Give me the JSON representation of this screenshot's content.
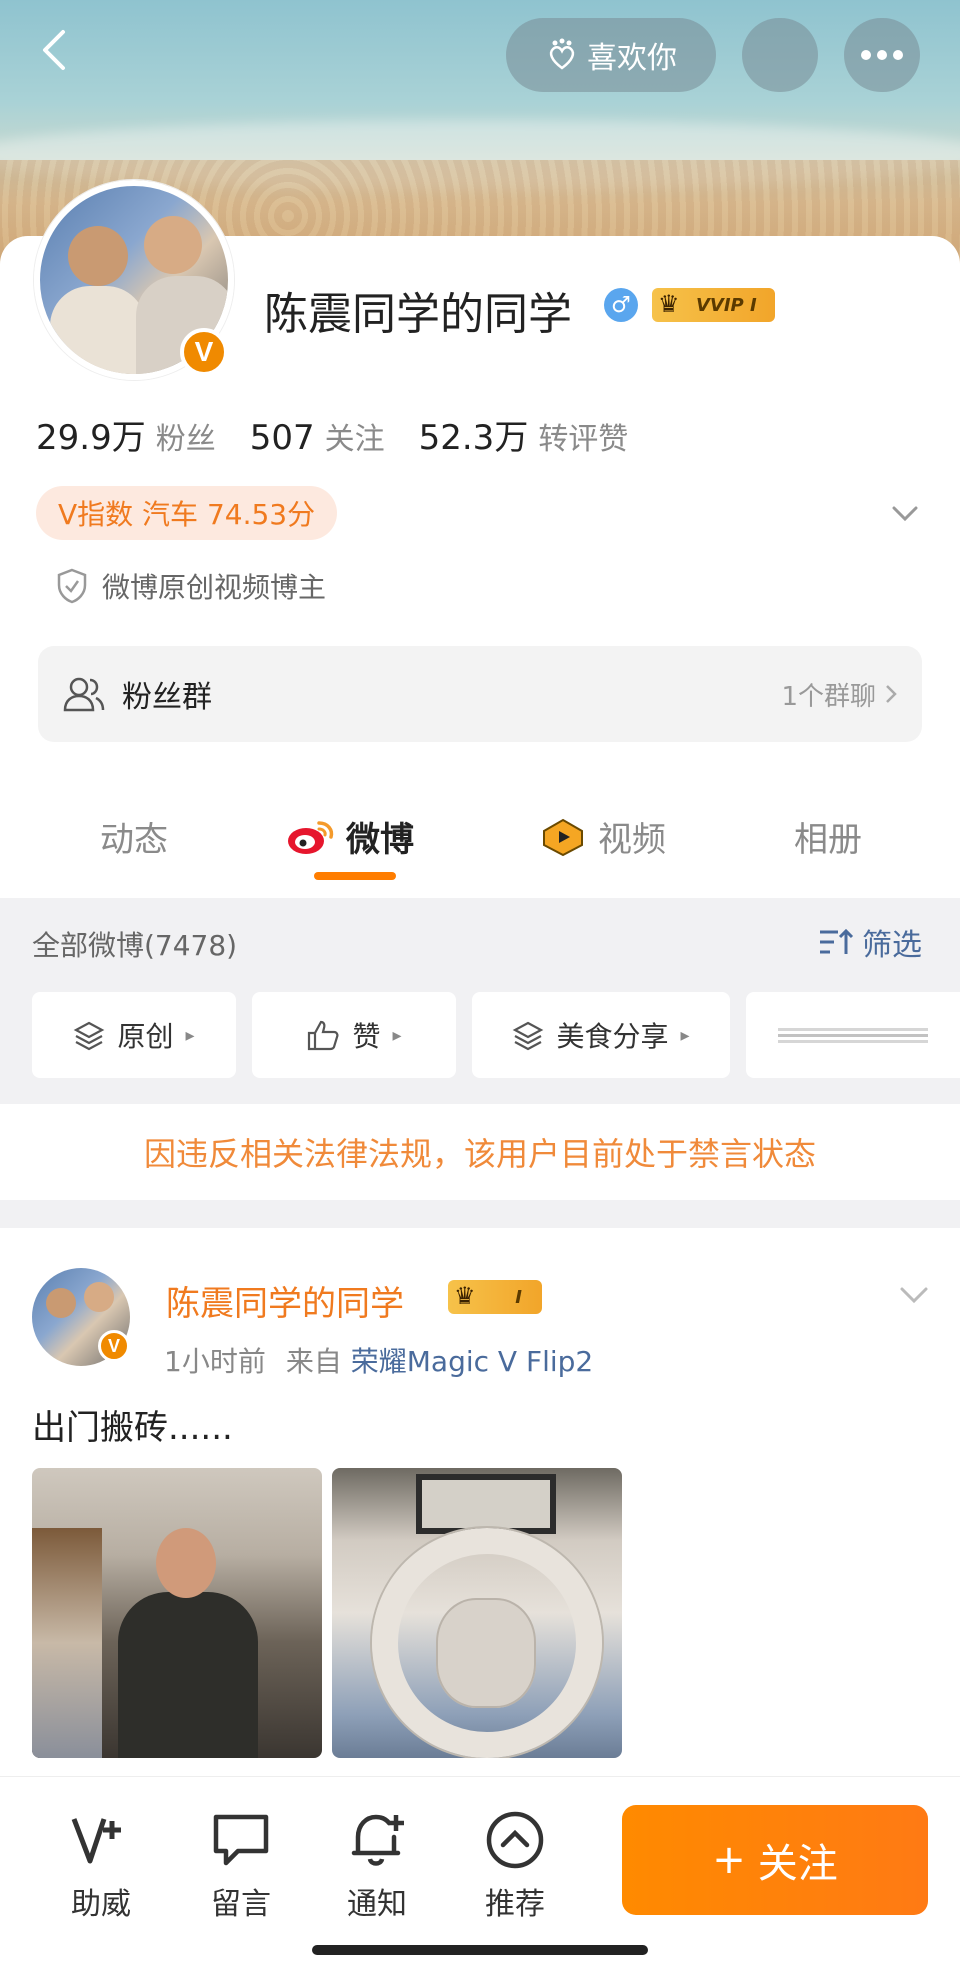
{
  "header": {
    "like_label": "喜欢你"
  },
  "profile": {
    "name": "陈震同学的同学",
    "gender_symbol": "♂",
    "vip_label": "VVIP I",
    "verified_badge": "V",
    "stats": [
      {
        "value": "29.9万",
        "label": "粉丝"
      },
      {
        "value": "507",
        "label": "关注"
      },
      {
        "value": "52.3万",
        "label": "转评赞"
      }
    ],
    "v_index": "V指数 汽车 74.53分",
    "certification": "微博原创视频博主",
    "fan_group": {
      "label": "粉丝群",
      "right_text": "1个群聊"
    }
  },
  "tabs": [
    {
      "label": "动态",
      "active": false
    },
    {
      "label": "微博",
      "active": true
    },
    {
      "label": "视频",
      "active": false
    },
    {
      "label": "相册",
      "active": false
    }
  ],
  "filter": {
    "all_count": "全部微博(7478)",
    "screen_label": "筛选",
    "chips": [
      "原创",
      "赞",
      "美食分享"
    ]
  },
  "notice": "因违反相关法律法规，该用户目前处于禁言状态",
  "post": {
    "author": "陈震同学的同学",
    "vip_label": "I",
    "time": "1小时前",
    "from_label": "来自",
    "source": "荣耀Magic V Flip2",
    "text": "出门搬砖......"
  },
  "bottom_bar": {
    "items": [
      "助威",
      "留言",
      "通知",
      "推荐"
    ],
    "follow_label": "关注",
    "follow_plus": "+"
  },
  "colors": {
    "accent": "#ff7d00",
    "link": "#4a6b9c",
    "notice": "#f08a3a"
  }
}
